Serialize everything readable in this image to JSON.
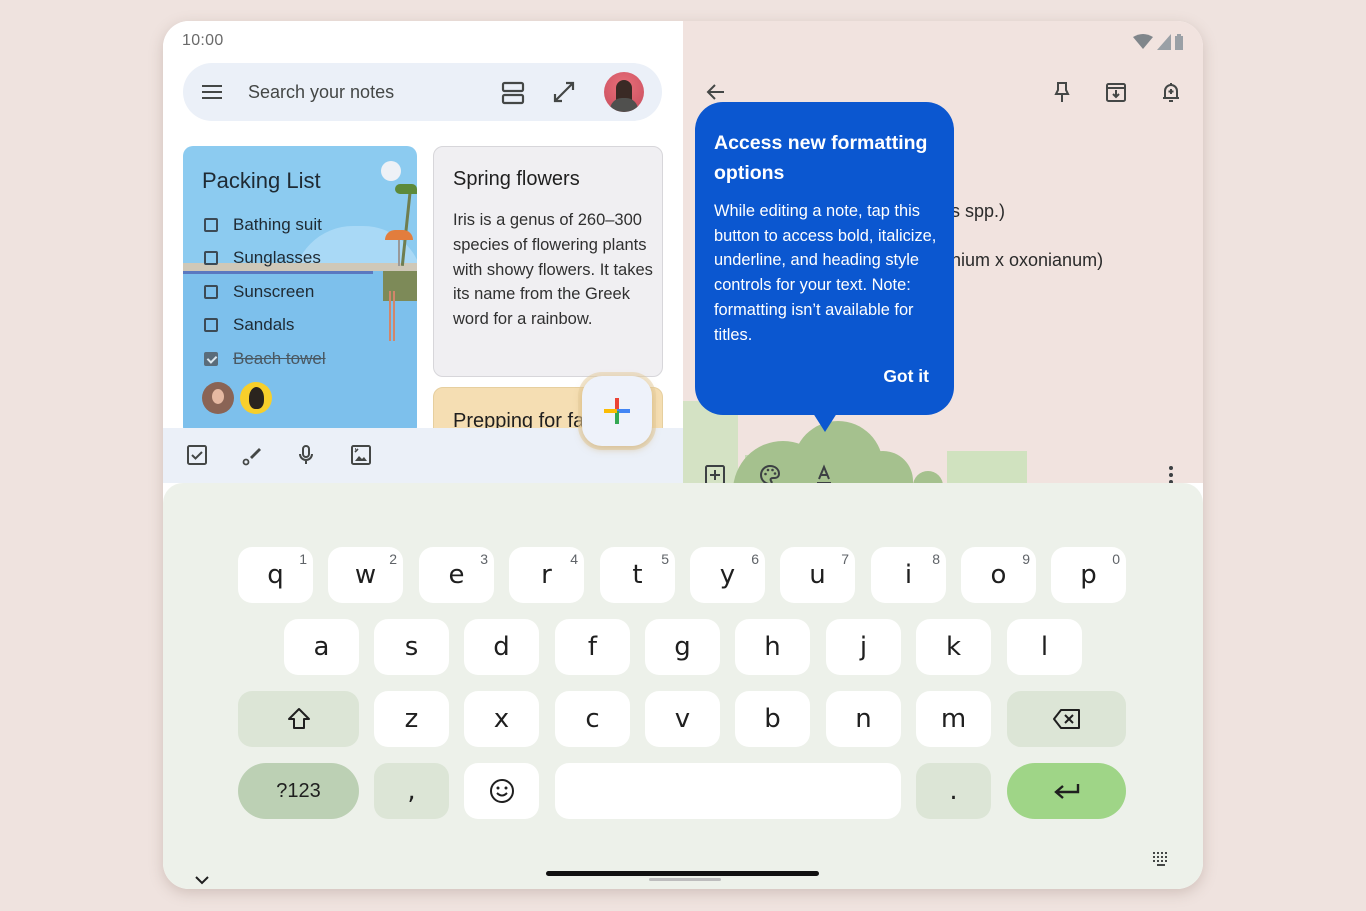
{
  "status_bar": {
    "time": "10:00"
  },
  "search": {
    "placeholder": "Search your notes"
  },
  "notes": {
    "packing_list": {
      "title": "Packing List",
      "items": [
        {
          "label": "Bathing suit",
          "checked": false
        },
        {
          "label": "Sunglasses",
          "checked": false
        },
        {
          "label": "Sunscreen",
          "checked": false
        },
        {
          "label": "Sandals",
          "checked": false
        },
        {
          "label": "Beach towel",
          "checked": true
        }
      ]
    },
    "spring_flowers": {
      "title": "Spring flowers",
      "body": "Iris is a genus of 260–300 species of flowering plants with showy flowers. It takes its name from the Greek word for a rainbow."
    },
    "prepping": {
      "title": "Prepping for fa"
    }
  },
  "editor": {
    "visible_lines": [
      "s spp.)",
      "nium x oxonianum)"
    ]
  },
  "popover": {
    "title": "Access new formatting options",
    "body": "While editing a note, tap this button to access bold, italicize, underline, and heading style controls for your text. Note: formatting isn’t available for titles.",
    "action": "Got it"
  },
  "keyboard": {
    "row1": [
      {
        "key": "q",
        "hint": "1"
      },
      {
        "key": "w",
        "hint": "2"
      },
      {
        "key": "e",
        "hint": "3"
      },
      {
        "key": "r",
        "hint": "4"
      },
      {
        "key": "t",
        "hint": "5"
      },
      {
        "key": "y",
        "hint": "6"
      },
      {
        "key": "u",
        "hint": "7"
      },
      {
        "key": "i",
        "hint": "8"
      },
      {
        "key": "o",
        "hint": "9"
      },
      {
        "key": "p",
        "hint": "0"
      }
    ],
    "row2": [
      "a",
      "s",
      "d",
      "f",
      "g",
      "h",
      "j",
      "k",
      "l"
    ],
    "row3": [
      "z",
      "x",
      "c",
      "v",
      "b",
      "n",
      "m"
    ],
    "symbols_label": "?123",
    "comma": ",",
    "period": "."
  },
  "colors": {
    "accent": "#0b57d0",
    "enter_key": "#9fd587",
    "symbols_key": "#bcd0b4",
    "packing_card": "#8ccbf0",
    "prepping_card": "#f5deb3"
  }
}
